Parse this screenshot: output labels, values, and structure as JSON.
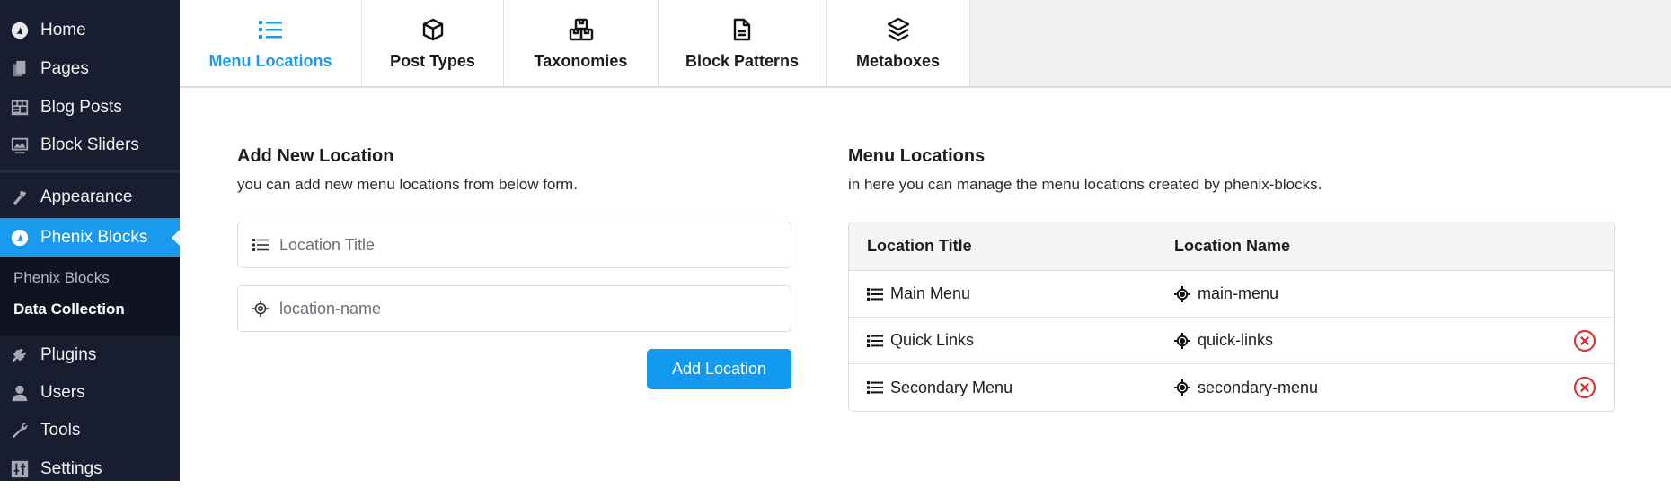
{
  "sidebar": {
    "items": [
      {
        "label": "Home",
        "icon": "phenix-logo-icon"
      },
      {
        "label": "Pages",
        "icon": "pages-icon"
      },
      {
        "label": "Blog Posts",
        "icon": "blog-posts-icon"
      },
      {
        "label": "Block Sliders",
        "icon": "slider-icon"
      },
      {
        "label": "Appearance",
        "icon": "paintbrush-icon"
      },
      {
        "label": "Phenix Blocks",
        "icon": "phenix-logo-icon",
        "active": true
      },
      {
        "label": "Plugins",
        "icon": "plugin-icon"
      },
      {
        "label": "Users",
        "icon": "user-icon"
      },
      {
        "label": "Tools",
        "icon": "wrench-icon"
      },
      {
        "label": "Settings",
        "icon": "settings-icon"
      }
    ],
    "submenu": [
      {
        "label": "Phenix Blocks"
      },
      {
        "label": "Data Collection",
        "current": true
      }
    ]
  },
  "tabs": [
    {
      "label": "Menu Locations",
      "icon": "list-icon",
      "active": true
    },
    {
      "label": "Post Types",
      "icon": "cube-icon"
    },
    {
      "label": "Taxonomies",
      "icon": "boxes-icon"
    },
    {
      "label": "Block Patterns",
      "icon": "document-icon"
    },
    {
      "label": "Metaboxes",
      "icon": "layers-icon"
    }
  ],
  "add_form": {
    "title": "Add New Location",
    "subtitle": "you can add new menu locations from below form.",
    "title_field": {
      "placeholder": "Location Title",
      "value": ""
    },
    "name_field": {
      "placeholder": "location-name",
      "value": ""
    },
    "submit_label": "Add Location"
  },
  "locations": {
    "title": "Menu Locations",
    "subtitle": "in here you can manage the menu locations created by phenix-blocks.",
    "columns": [
      "Location Title",
      "Location Name"
    ],
    "rows": [
      {
        "title": "Main Menu",
        "name": "main-menu",
        "deletable": false
      },
      {
        "title": "Quick Links",
        "name": "quick-links",
        "deletable": true
      },
      {
        "title": "Secondary Menu",
        "name": "secondary-menu",
        "deletable": true
      }
    ]
  },
  "colors": {
    "accent": "#1a9aef",
    "sidebar_bg": "#181d2f",
    "danger": "#d63638"
  }
}
